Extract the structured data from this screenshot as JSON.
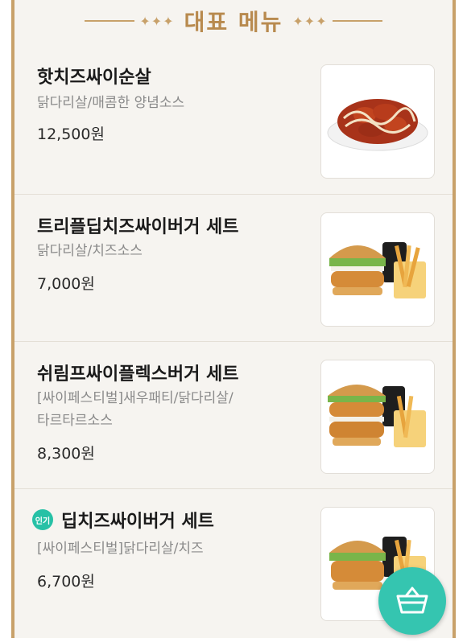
{
  "header": {
    "title": "대표 메뉴",
    "ornament_left": "✦✦✦",
    "ornament_right": "✦✦✦"
  },
  "menu_items": [
    {
      "name": "핫치즈싸이순살",
      "desc": "닭다리살/매콤한 양념소스",
      "price": "12,500원",
      "image": "spicy-boneless-chicken"
    },
    {
      "name": "트리플딥치즈싸이버거 세트",
      "desc": "닭다리살/치즈소스",
      "price": "7,000원",
      "image": "burger-set-fries-drink"
    },
    {
      "name": "쉬림프싸이플렉스버거 세트",
      "desc_line1": "[싸이페스티벌]새우패티/닭다리살/",
      "desc_line2": "타르타르소스",
      "price": "8,300원",
      "image": "double-patty-burger-set"
    },
    {
      "badge": "인기",
      "name": "딥치즈싸이버거 세트",
      "desc": "[싸이페스티벌]닭다리살/치즈",
      "price": "6,700원",
      "image": "burger-set-fries-drink"
    }
  ],
  "fab": {
    "icon": "basket-icon"
  },
  "colors": {
    "accent_gold": "#c8a16a",
    "badge_teal": "#27c1a6",
    "fab_teal": "#35c5b0"
  }
}
